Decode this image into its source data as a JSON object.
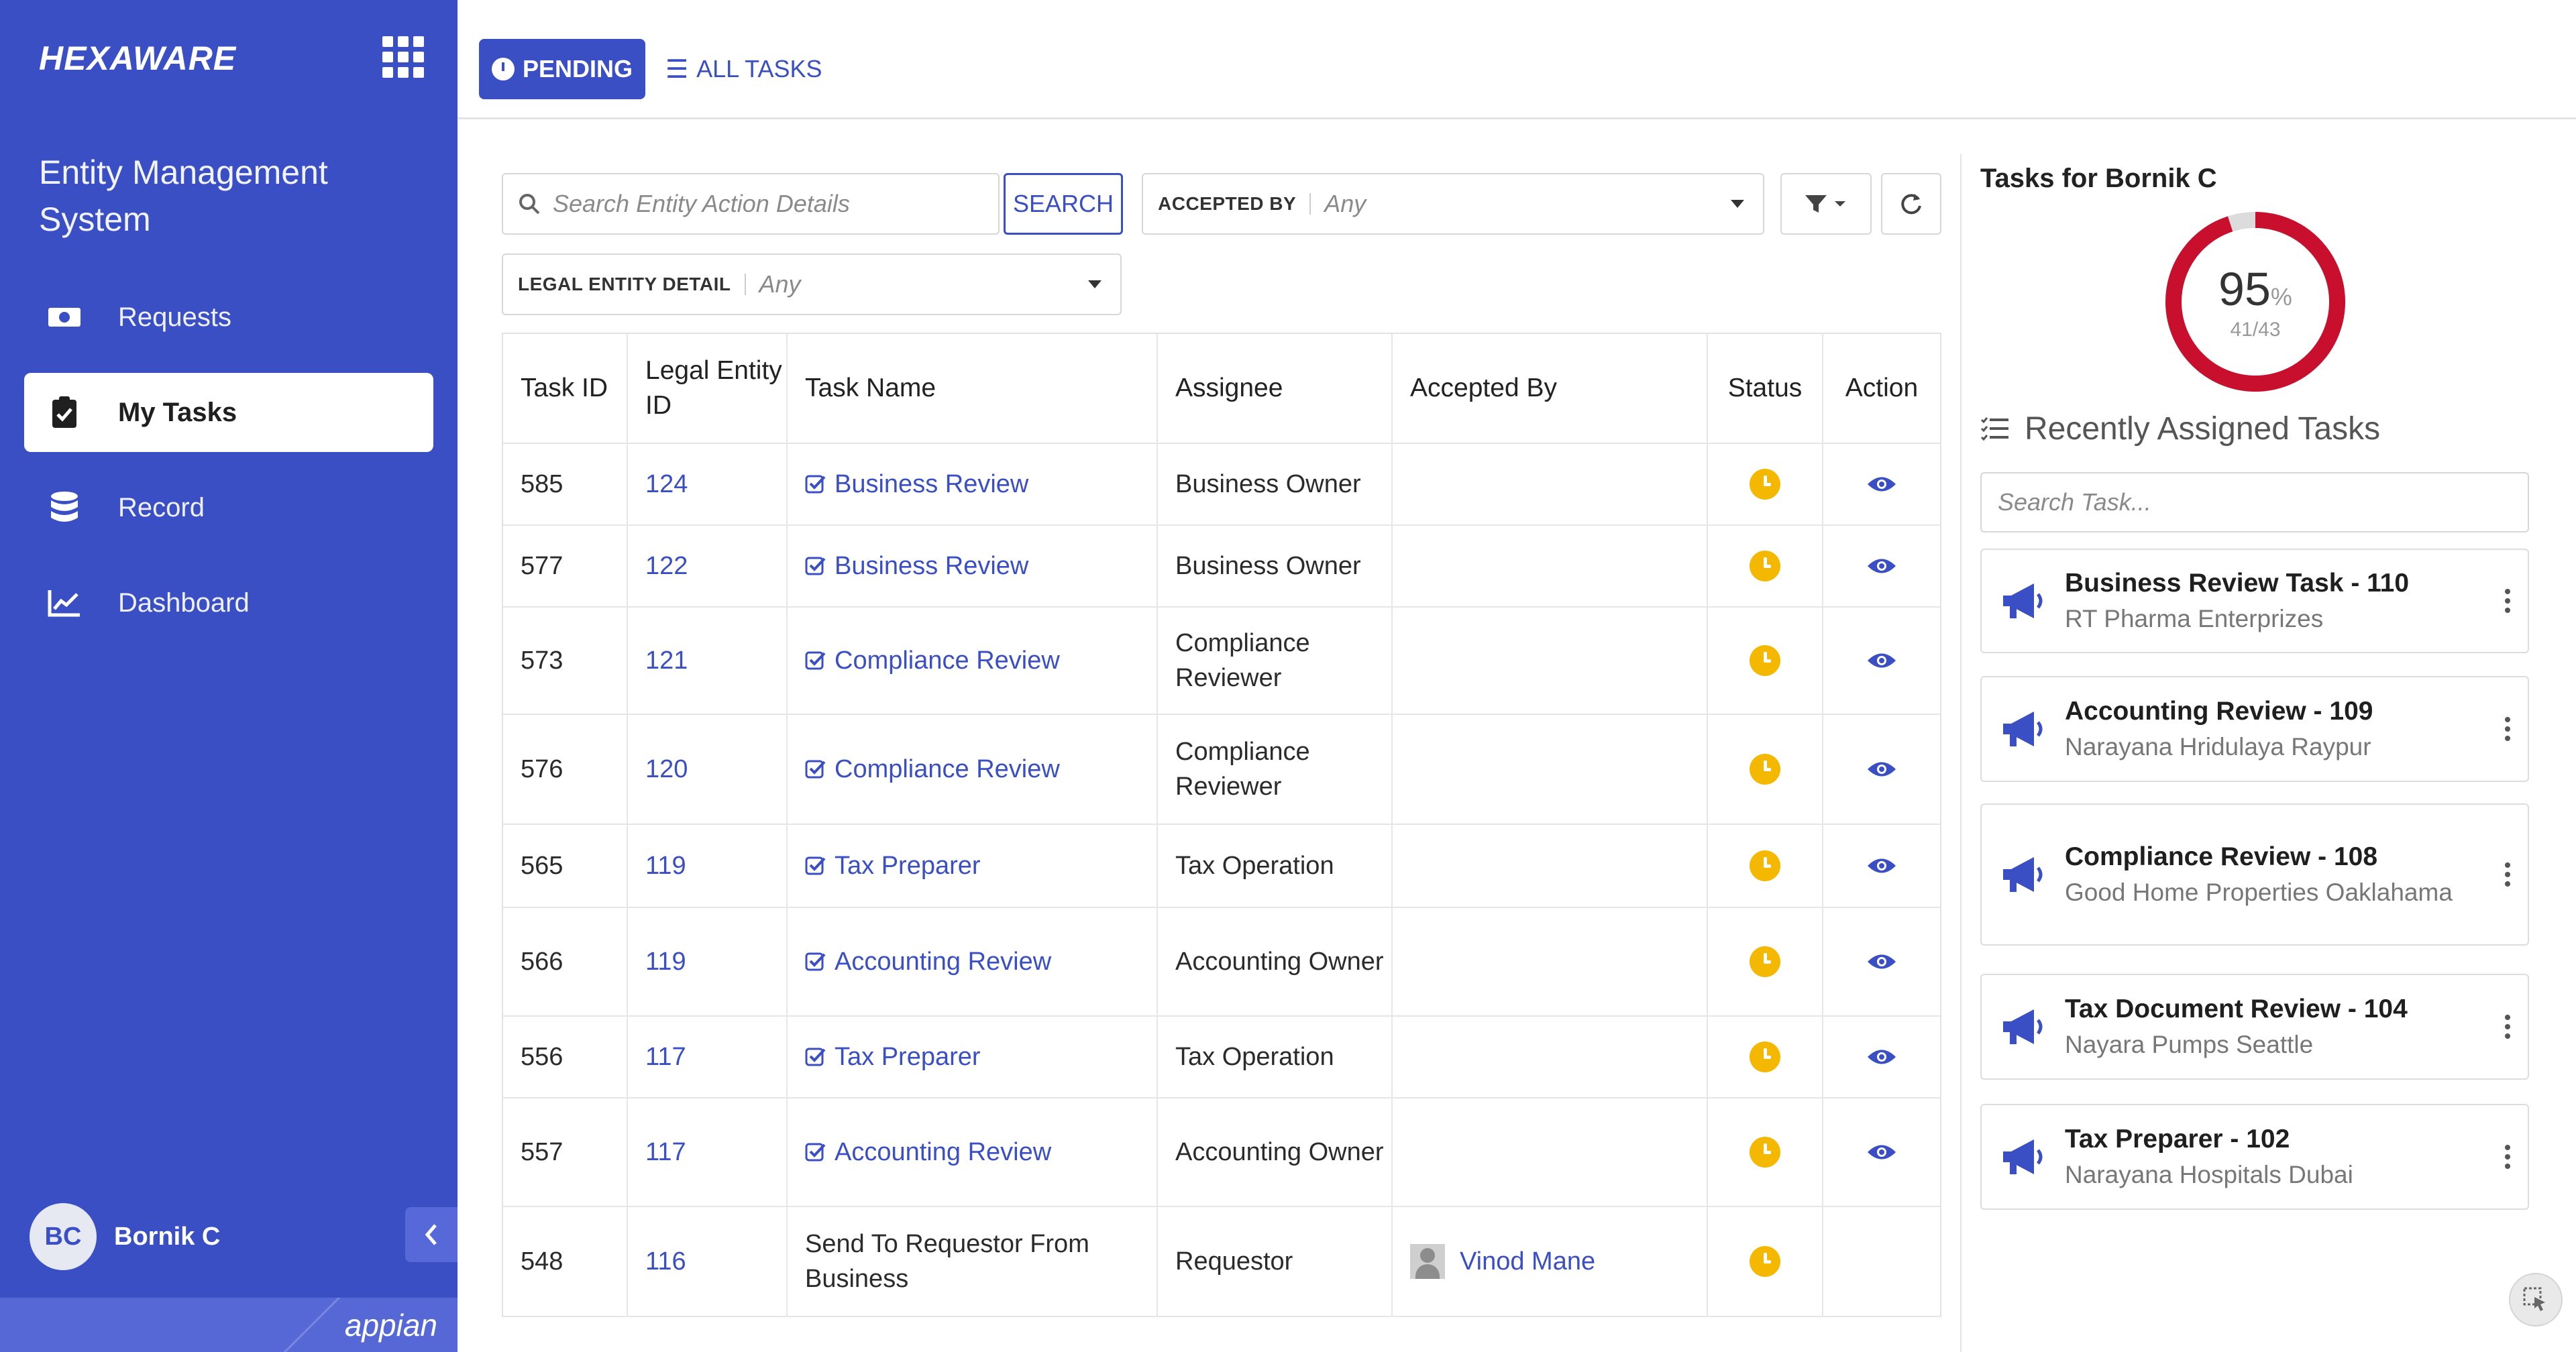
{
  "brand": "HEXAWARE",
  "app_title": "Entity Management System",
  "nav": [
    {
      "label": "Requests",
      "icon": "money-icon",
      "active": false
    },
    {
      "label": "My Tasks",
      "icon": "clipboard-check-icon",
      "active": true
    },
    {
      "label": "Record",
      "icon": "database-icon",
      "active": false
    },
    {
      "label": "Dashboard",
      "icon": "chart-line-icon",
      "active": false
    }
  ],
  "user": {
    "initials": "BC",
    "name": "Bornik C"
  },
  "footer_logo": "appian",
  "tabs": {
    "pending": "PENDING",
    "all": "ALL TASKS"
  },
  "filters": {
    "search_placeholder": "Search Entity Action Details",
    "search_button": "SEARCH",
    "accepted_by_label": "ACCEPTED BY",
    "accepted_by_value": "Any",
    "legal_entity_label": "LEGAL ENTITY DETAIL",
    "legal_entity_value": "Any"
  },
  "table": {
    "headers": [
      "Task ID",
      "Legal Entity ID",
      "Task Name",
      "Assignee",
      "Accepted By",
      "Status",
      "Action"
    ],
    "rows": [
      {
        "task_id": "585",
        "entity_id": "124",
        "task_name": "Business Review",
        "assignee": "Business Owner",
        "accepted_by": ""
      },
      {
        "task_id": "577",
        "entity_id": "122",
        "task_name": "Business Review",
        "assignee": "Business Owner",
        "accepted_by": ""
      },
      {
        "task_id": "573",
        "entity_id": "121",
        "task_name": "Compliance Review",
        "assignee": "Compliance Reviewer",
        "accepted_by": ""
      },
      {
        "task_id": "576",
        "entity_id": "120",
        "task_name": "Compliance Review",
        "assignee": "Compliance Reviewer",
        "accepted_by": ""
      },
      {
        "task_id": "565",
        "entity_id": "119",
        "task_name": "Tax Preparer",
        "assignee": "Tax Operation",
        "accepted_by": ""
      },
      {
        "task_id": "566",
        "entity_id": "119",
        "task_name": "Accounting Review",
        "assignee": "Accounting Owner",
        "accepted_by": ""
      },
      {
        "task_id": "556",
        "entity_id": "117",
        "task_name": "Tax Preparer",
        "assignee": "Tax Operation",
        "accepted_by": ""
      },
      {
        "task_id": "557",
        "entity_id": "117",
        "task_name": "Accounting Review",
        "assignee": "Accounting Owner",
        "accepted_by": ""
      },
      {
        "task_id": "548",
        "entity_id": "116",
        "task_name": "Send To Requestor From Business",
        "assignee": "Requestor",
        "accepted_by": "Vinod Mane"
      }
    ]
  },
  "right_panel": {
    "title": "Tasks for Bornik C",
    "percent": "95",
    "percent_sign": "%",
    "completion_fraction": 0.95,
    "fraction": "41/43",
    "recent_title": "Recently Assigned Tasks",
    "search_placeholder": "Search Task...",
    "cards": [
      {
        "title": "Business Review Task - 110",
        "subtitle": "RT Pharma Enterprizes"
      },
      {
        "title": "Accounting Review - 109",
        "subtitle": "Narayana Hridulaya Raypur"
      },
      {
        "title": "Compliance Review - 108",
        "subtitle": "Good Home Properties Oaklahama"
      },
      {
        "title": "Tax Document Review - 104",
        "subtitle": "Nayara Pumps Seattle"
      },
      {
        "title": "Tax Preparer - 102",
        "subtitle": "Narayana Hospitals Dubai"
      }
    ]
  },
  "colors": {
    "primary": "#3b4fc4",
    "status_pending": "#f5b800",
    "donut": "#c8102e"
  }
}
